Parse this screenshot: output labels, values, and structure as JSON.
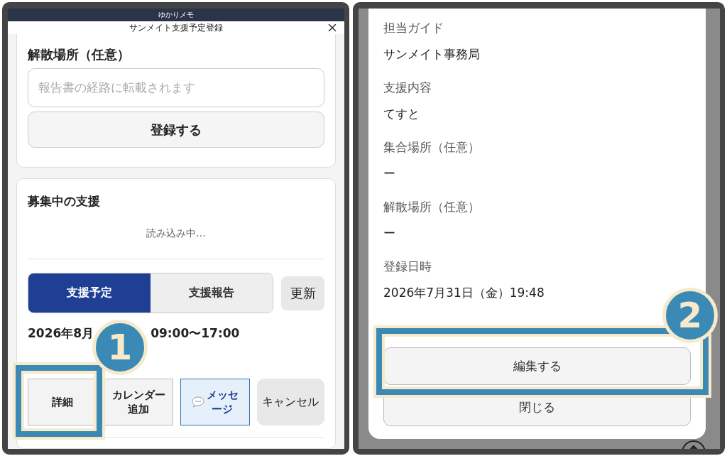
{
  "left_screen": {
    "app_bar": {
      "title": "ゆかりメモ"
    },
    "dialog": {
      "title": "サンメイト支援予定登録"
    },
    "form_card": {
      "label": "解散場所（任意）",
      "field": {
        "placeholder": "報告書の経路に転載されます"
      },
      "submit": "登録する"
    },
    "recruiting_card": {
      "title": "募集中の支援",
      "loading": "読み込み中...",
      "tabs": [
        {
          "label": "支援予定",
          "selected": true
        },
        {
          "label": "支援報告",
          "selected": false
        }
      ],
      "refresh": "更新",
      "schedule": {
        "date_start": "2026年8月",
        "time": "09:00〜17:00"
      },
      "actions": [
        {
          "kind": "plain",
          "lines": [
            "詳細"
          ]
        },
        {
          "kind": "plain",
          "lines": [
            "カレンダー",
            "追加"
          ]
        },
        {
          "kind": "message",
          "lines": [
            "メッセ",
            "ージ"
          ]
        },
        {
          "kind": "muted",
          "lines": [
            "キャンセル"
          ]
        }
      ]
    }
  },
  "right_screen": {
    "detail_modal": {
      "fields": [
        {
          "label": "担当ガイド",
          "value": "サンメイト事務局"
        },
        {
          "label": "支援内容",
          "value": "てすと"
        },
        {
          "label": "集合場所（任意）",
          "value": "ー"
        },
        {
          "label": "解散場所（任意）",
          "value": "ー"
        },
        {
          "label": "登録日時",
          "value": "2026年7月31日（金）19:48"
        }
      ],
      "buttons": [
        "編集する",
        "閉じる"
      ]
    }
  },
  "annotations": [
    {
      "number": "1"
    },
    {
      "number": "2"
    }
  ]
}
